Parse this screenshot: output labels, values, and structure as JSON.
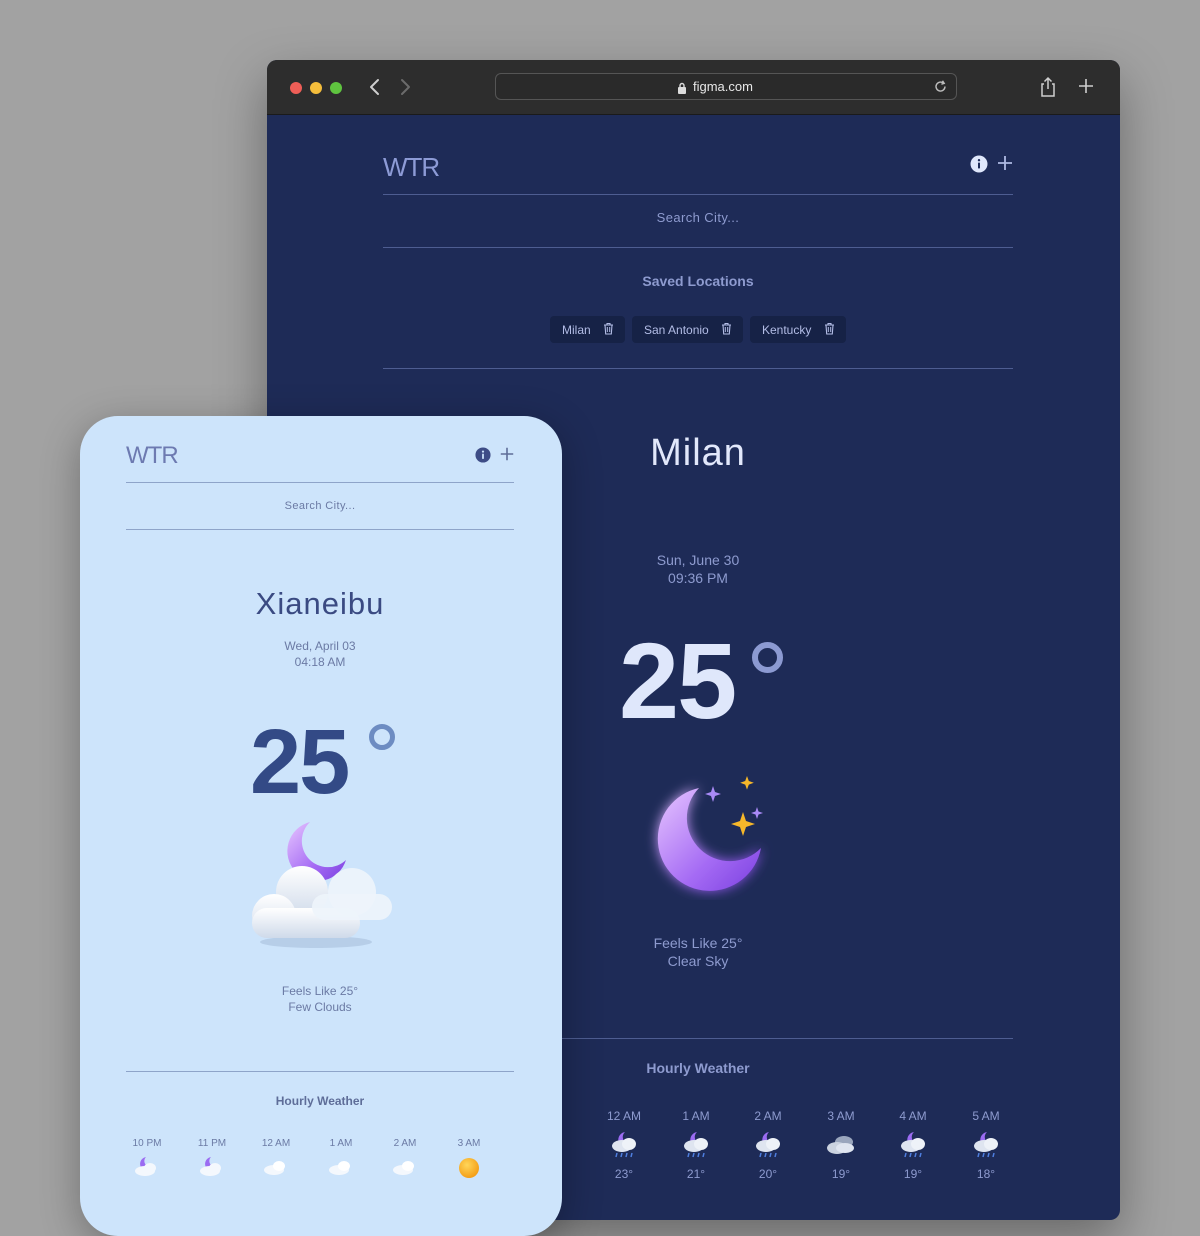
{
  "browser": {
    "url": "figma.com"
  },
  "desktop": {
    "logo": "WTR",
    "search_placeholder": "Search City...",
    "saved_title": "Saved Locations",
    "saved_locations": [
      "Milan",
      "San Antonio",
      "Kentucky"
    ],
    "city": "Milan",
    "date": "Sun, June 30",
    "time": "09:36 PM",
    "temperature": "25",
    "feels_like": "Feels Like 25°",
    "condition": "Clear Sky",
    "weather_icon": "moon-stars-icon",
    "hourly_title": "Hourly Weather",
    "hourly": [
      {
        "time": "12 AM",
        "temp": "23°",
        "icon": "moon-cloud-rain-icon"
      },
      {
        "time": "1 AM",
        "temp": "21°",
        "icon": "moon-cloud-rain-icon"
      },
      {
        "time": "2 AM",
        "temp": "20°",
        "icon": "moon-cloud-rain-icon"
      },
      {
        "time": "3 AM",
        "temp": "19°",
        "icon": "clouds-icon"
      },
      {
        "time": "4 AM",
        "temp": "19°",
        "icon": "moon-cloud-rain-icon"
      },
      {
        "time": "5 AM",
        "temp": "18°",
        "icon": "moon-cloud-rain-icon"
      }
    ]
  },
  "mobile": {
    "logo": "WTR",
    "search_placeholder": "Search City...",
    "city": "Xianeibu",
    "date": "Wed, April 03",
    "time": "04:18 AM",
    "temperature": "25",
    "feels_like": "Feels Like 25°",
    "condition": "Few Clouds",
    "weather_icon": "moon-cloud-icon",
    "hourly_title": "Hourly Weather",
    "hourly": [
      {
        "time": "10 PM",
        "icon": "moon-cloud-icon"
      },
      {
        "time": "11 PM",
        "icon": "moon-cloud-icon"
      },
      {
        "time": "12 AM",
        "icon": "cloud-icon"
      },
      {
        "time": "1 AM",
        "icon": "cloud-icon"
      },
      {
        "time": "2 AM",
        "icon": "cloud-icon"
      },
      {
        "time": "3 AM",
        "icon": "sun-icon"
      }
    ]
  },
  "colors": {
    "desktop_bg": "#1e2b57",
    "mobile_bg": "#cde4fb",
    "accent_purple": "#9b6cf2",
    "star_yellow": "#f6b72a"
  }
}
